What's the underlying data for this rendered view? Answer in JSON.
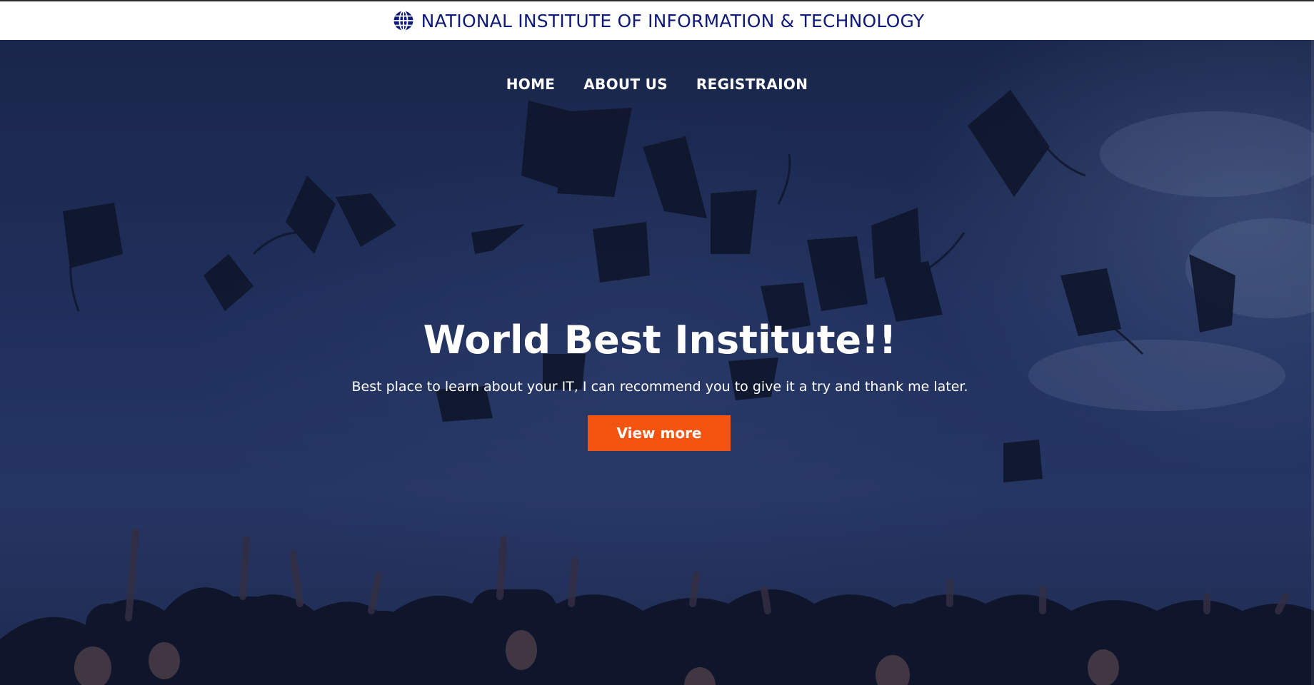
{
  "brand": {
    "icon": "globe-icon",
    "title": "NATIONAL INSTITUTE OF INFORMATION & TECHNOLOGY",
    "color": "#0f1a7a"
  },
  "nav": {
    "items": [
      {
        "label": "HOME"
      },
      {
        "label": "ABOUT US"
      },
      {
        "label": "REGISTRAION"
      }
    ]
  },
  "hero": {
    "title": "World Best Institute!!",
    "subtitle": "Best place to learn about your IT, I can recommend you to give it a try and thank me later.",
    "button_label": "View more",
    "button_color": "#f35410",
    "background": "graduation-caps-thrown-photo"
  }
}
